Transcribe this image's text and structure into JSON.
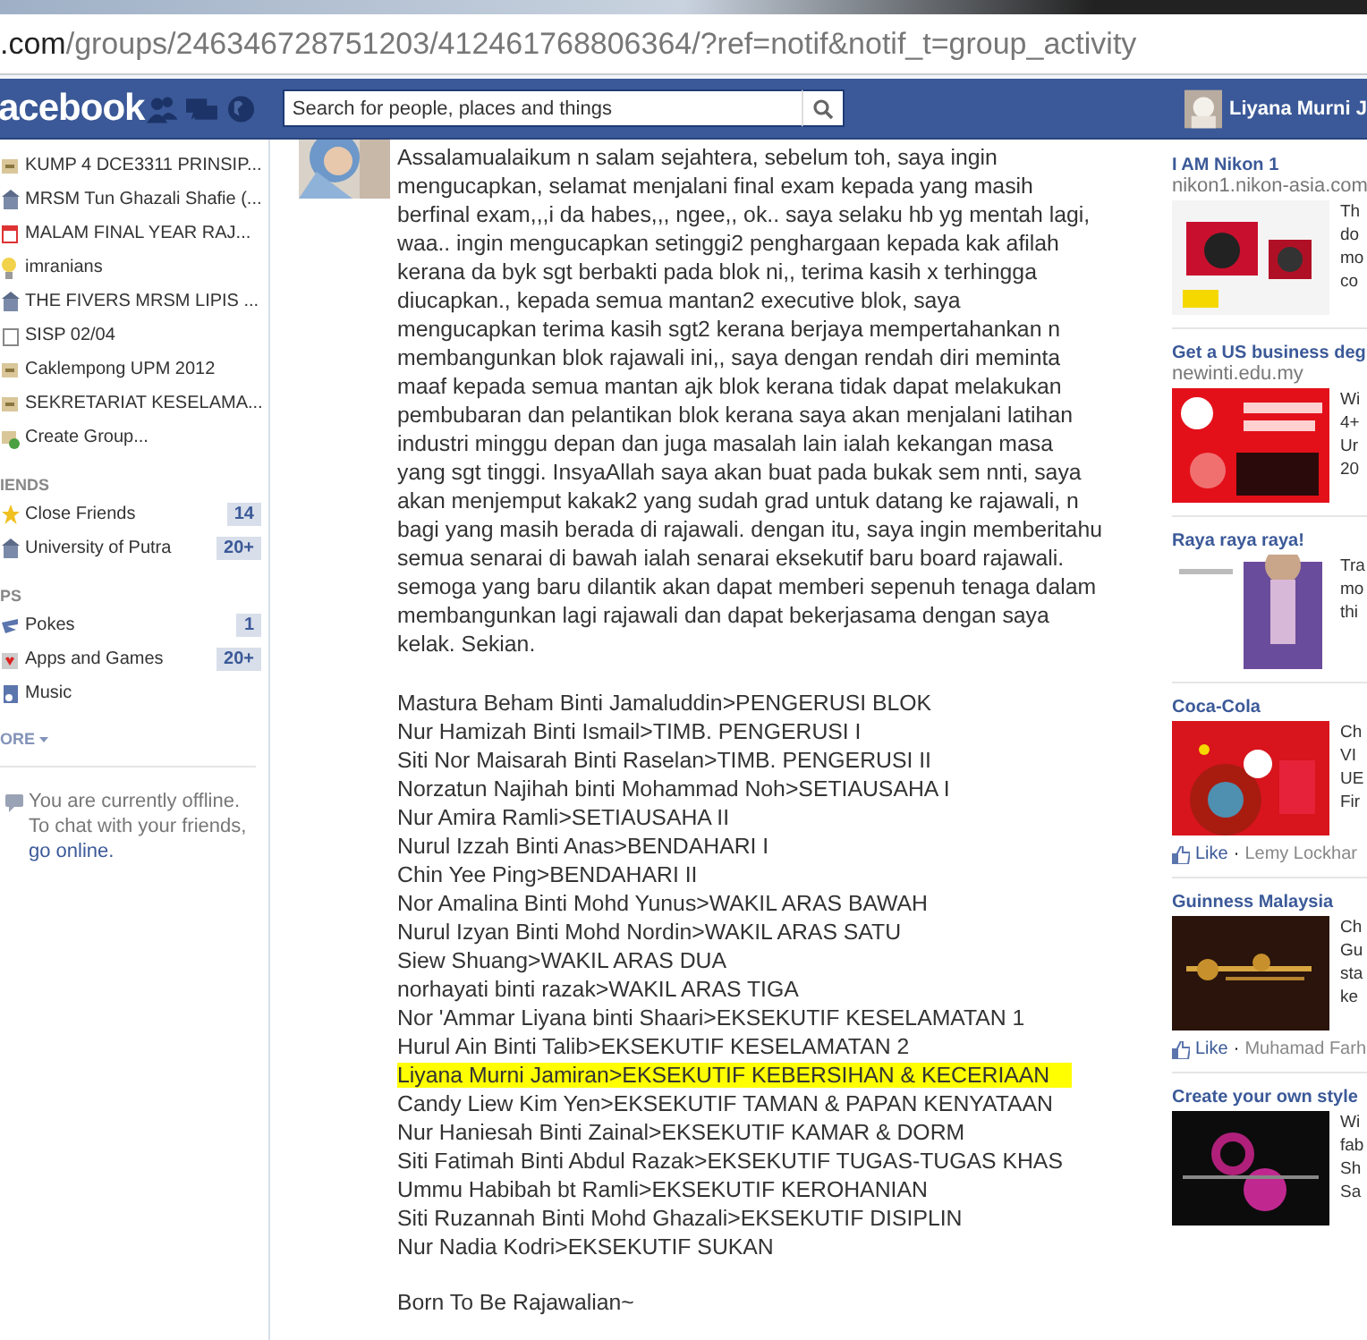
{
  "browser": {
    "url_host": ".com",
    "url_path": "/groups/246346728751203/412461768806364/?ref=notif&notif_t=group_activity"
  },
  "topbar": {
    "logo": "acebook",
    "search": {
      "placeholder": "Search for people, places and things"
    },
    "user_name": "Liyana Murni J"
  },
  "sidebar": {
    "items": [
      {
        "kind": "link",
        "label": "KUMP 4 DCE3311 PRINSIP..."
      },
      {
        "kind": "link",
        "label": "MRSM Tun Ghazali Shafie (..."
      },
      {
        "kind": "link",
        "label": "MALAM FINAL YEAR RAJ..."
      },
      {
        "kind": "link",
        "label": "imranians"
      },
      {
        "kind": "link",
        "label": "THE FIVERS MRSM LIPIS ..."
      },
      {
        "kind": "link",
        "label": "SISP 02/04"
      },
      {
        "kind": "link",
        "label": "Caklempong UPM 2012"
      },
      {
        "kind": "link",
        "label": "SEKRETARIAT KESELAMA..."
      },
      {
        "kind": "link",
        "label": "Create Group..."
      },
      {
        "kind": "heading",
        "label": "IENDS"
      },
      {
        "kind": "link",
        "label": "Close Friends",
        "count": "14"
      },
      {
        "kind": "link",
        "label": "University of Putra",
        "count": "20+"
      },
      {
        "kind": "heading",
        "label": "PS"
      },
      {
        "kind": "link",
        "label": "Pokes",
        "count": "1"
      },
      {
        "kind": "link",
        "label": "Apps and Games",
        "count": "20+"
      },
      {
        "kind": "link",
        "label": "Music"
      },
      {
        "kind": "more",
        "label": "ORE"
      }
    ],
    "offline": {
      "text": "You are currently offline. To chat with your friends,",
      "link": "go online."
    }
  },
  "post": {
    "body": "Assalamualaikum n salam sejahtera, sebelum toh, saya ingin mengucapkan, selamat menjalani final exam kepada yang masih berfinal exam,,,i da habes,,, ngee,, ok.. saya selaku hb yg mentah lagi, waa.. ingin mengucapkan setinggi2 penghargaan kepada kak afilah kerana da byk sgt berbakti pada blok ni,, terima kasih x terhingga diucapkan., kepada semua mantan2 executive blok, saya mengucapkan terima kasih sgt2 kerana berjaya mempertahankan n membangunkan blok rajawali ini,, saya dengan rendah diri meminta maaf kepada semua mantan ajk blok kerana tidak dapat melakukan pembubaran dan pelantikan blok kerana saya akan menjalani latihan industri minggu depan dan juga masalah lain ialah kekangan masa yang sgt tinggi. InsyaAllah saya akan buat pada bukak sem nnti, saya akan menjemput kakak2 yang sudah grad untuk datang ke rajawali, n bagi yang masih berada di rajawali. dengan itu, saya ingin memberitahu semua senarai di bawah ialah senarai eksekutif baru board rajawali. semoga yang baru dilantik akan dapat memberi sepenuh tenaga dalam membangunkan lagi rajawali dan dapat bekerjasama dengan saya kelak. Sekian.",
    "roster": [
      {
        "text": "Mastura Beham Binti Jamaluddin>PENGERUSI BLOK",
        "highlighted": false
      },
      {
        "text": "Nur Hamizah Binti Ismail>TIMB. PENGERUSI I",
        "highlighted": false
      },
      {
        "text": "Siti Nor Maisarah Binti Raselan>TIMB. PENGERUSI II",
        "highlighted": false
      },
      {
        "text": "Norzatun Najihah binti Mohammad Noh>SETIAUSAHA I",
        "highlighted": false
      },
      {
        "text": "Nur Amira Ramli>SETIAUSAHA II",
        "highlighted": false
      },
      {
        "text": "Nurul Izzah Binti Anas>BENDAHARI I",
        "highlighted": false
      },
      {
        "text": "Chin Yee Ping>BENDAHARI II",
        "highlighted": false
      },
      {
        "text": "Nor Amalina Binti Mohd Yunus>WAKIL ARAS BAWAH",
        "highlighted": false
      },
      {
        "text": "Nurul Izyan Binti Mohd Nordin>WAKIL ARAS SATU",
        "highlighted": false
      },
      {
        "text": "Siew Shuang>WAKIL ARAS DUA",
        "highlighted": false
      },
      {
        "text": "norhayati binti razak>WAKIL ARAS TIGA",
        "highlighted": false
      },
      {
        "text": "Nor 'Ammar Liyana binti Shaari>EKSEKUTIF KESELAMATAN 1",
        "highlighted": false
      },
      {
        "text": "Hurul Ain Binti Talib>EKSEKUTIF KESELAMATAN 2",
        "highlighted": false
      },
      {
        "text": "Liyana Murni Jamiran>EKSEKUTIF KEBERSIHAN & KECERIAAN",
        "highlighted": true
      },
      {
        "text": "Candy Liew Kim Yen>EKSEKUTIF TAMAN & PAPAN KENYATAAN",
        "highlighted": false
      },
      {
        "text": "Nur Haniesah Binti Zainal>EKSEKUTIF KAMAR & DORM",
        "highlighted": false
      },
      {
        "text": "Siti Fatimah Binti Abdul Razak>EKSEKUTIF TUGAS-TUGAS KHAS",
        "highlighted": false
      },
      {
        "text": "Ummu Habibah bt Ramli>EKSEKUTIF KEROHANIAN",
        "highlighted": false
      },
      {
        "text": "Siti Ruzannah Binti Mohd Ghazali>EKSEKUTIF DISIPLIN",
        "highlighted": false
      },
      {
        "text": "Nur Nadia Kodri>EKSEKUTIF SUKAN",
        "highlighted": false
      }
    ],
    "signature": "Born To Be Rajawalian~"
  },
  "ads": [
    {
      "title": "I AM Nikon 1",
      "domain": "nikon1.nikon-asia.com",
      "body_lines": [
        "Th",
        "do",
        "mo",
        "co"
      ]
    },
    {
      "title": "Get a US business deg",
      "domain": "newinti.edu.my",
      "body_lines": [
        "Wi",
        "4+",
        "Ur",
        "20"
      ]
    },
    {
      "title": "Raya raya raya!",
      "body_lines": [
        "Tra",
        "mo",
        "thi"
      ]
    },
    {
      "title": "Coca-Cola",
      "body_lines": [
        "Ch",
        "VI",
        "UE",
        "Fir"
      ],
      "like": {
        "label": "Like",
        "separator": "·",
        "by": "Lemy Lockhar"
      }
    },
    {
      "title": "Guinness Malaysia",
      "body_lines": [
        "Ch",
        "Gu",
        "sta",
        "ke"
      ],
      "like": {
        "label": "Like",
        "separator": "·",
        "by": "Muhamad Farh"
      }
    },
    {
      "title": "Create your own style",
      "body_lines": [
        "Wi",
        "fab",
        "Sh",
        "Sa"
      ]
    }
  ]
}
